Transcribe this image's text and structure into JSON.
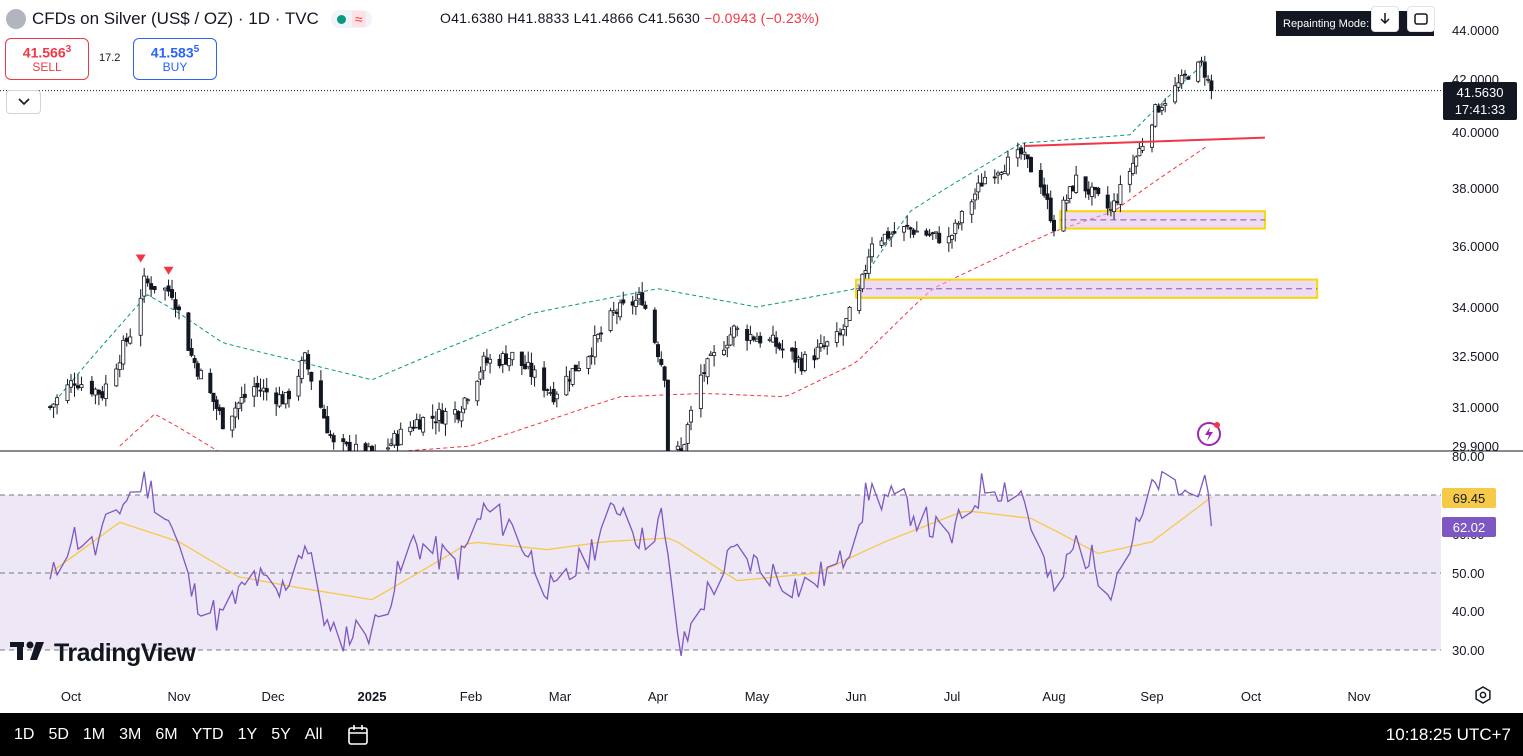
{
  "header": {
    "symbol_title": "CFDs on Silver (US$ / OZ) · 1D · TVC",
    "ohlc": {
      "o": "O41.6380",
      "h": "H41.8833",
      "l": "L41.4866",
      "c": "C41.5630",
      "change": "−0.0943 (−0.23%)"
    }
  },
  "trade": {
    "sell_main": "41.566",
    "sell_sup": "3",
    "sell_label": "SELL",
    "spread": "17.2",
    "buy_main": "41.583",
    "buy_sup": "5",
    "buy_label": "BUY"
  },
  "repaint_label": "Repainting Mode: off",
  "last_price": {
    "value": "41.5630",
    "countdown": "17:41:33"
  },
  "rsi_tags": {
    "ma": "69.45",
    "rsi": "62.02"
  },
  "timeframes": [
    "1D",
    "5D",
    "1M",
    "3M",
    "6M",
    "YTD",
    "1Y",
    "5Y",
    "All"
  ],
  "clock": "10:18:25 UTC+7",
  "brand": "TradingView",
  "icons": {
    "collapse": "chevron-down-icon",
    "download": "download-icon",
    "fullscreen": "fullscreen-icon",
    "calendar": "calendar-icon",
    "settings": "gear-icon",
    "flash": "flash-icon"
  },
  "colors": {
    "up": "#131722",
    "down": "#131722",
    "upper_band": "#089981",
    "lower_band": "#f23645",
    "resistance": "#f23645",
    "zone_border": "#f5d90a",
    "zone_fill": "#e1bee7",
    "rsi_line": "#7e57c2",
    "rsi_ma": "#f7c948",
    "rsi_fill": "#ede7f6"
  },
  "chart_data": [
    {
      "type": "candlestick",
      "title": "CFDs on Silver (US$ / OZ) · 1D · TVC",
      "y_ticks": [
        29.9,
        31.0,
        32.5,
        34.0,
        36.0,
        38.0,
        40.0,
        42.0,
        44.0
      ],
      "y_tick_labels": [
        "29.9000",
        "31.0000",
        "32.5000",
        "34.0000",
        "36.0000",
        "38.0000",
        "40.0000",
        "42.0000",
        "44.0000"
      ],
      "ylim": [
        29.9,
        44.5
      ],
      "x_tick_labels": [
        "Oct",
        "Nov",
        "Dec",
        "2025",
        "Feb",
        "Mar",
        "Apr",
        "May",
        "Jun",
        "Jul",
        "Aug",
        "Sep",
        "Oct",
        "Nov"
      ],
      "grid": false,
      "close_anchors": [
        {
          "date": "2024-09-25",
          "close": 31.0
        },
        {
          "date": "2024-10-02",
          "close": 31.8
        },
        {
          "date": "2024-10-10",
          "close": 31.4
        },
        {
          "date": "2024-10-18",
          "close": 33.2
        },
        {
          "date": "2024-10-22",
          "close": 34.8
        },
        {
          "date": "2024-10-30",
          "close": 34.5
        },
        {
          "date": "2024-11-05",
          "close": 32.5
        },
        {
          "date": "2024-11-15",
          "close": 30.6
        },
        {
          "date": "2024-11-25",
          "close": 31.6
        },
        {
          "date": "2024-12-05",
          "close": 31.2
        },
        {
          "date": "2024-12-11",
          "close": 32.4
        },
        {
          "date": "2024-12-20",
          "close": 29.9
        },
        {
          "date": "2025-01-02",
          "close": 29.6
        },
        {
          "date": "2025-01-15",
          "close": 30.6
        },
        {
          "date": "2025-01-28",
          "close": 30.9
        },
        {
          "date": "2025-02-05",
          "close": 32.3
        },
        {
          "date": "2025-02-14",
          "close": 32.5
        },
        {
          "date": "2025-02-27",
          "close": 31.4
        },
        {
          "date": "2025-03-10",
          "close": 32.6
        },
        {
          "date": "2025-03-18",
          "close": 33.8
        },
        {
          "date": "2025-03-27",
          "close": 34.3
        },
        {
          "date": "2025-04-03",
          "close": 32.0
        },
        {
          "date": "2025-04-04",
          "close": 29.8
        },
        {
          "date": "2025-04-08",
          "close": 29.7
        },
        {
          "date": "2025-04-14",
          "close": 31.9
        },
        {
          "date": "2025-04-24",
          "close": 33.3
        },
        {
          "date": "2025-05-06",
          "close": 32.9
        },
        {
          "date": "2025-05-15",
          "close": 32.3
        },
        {
          "date": "2025-05-27",
          "close": 33.1
        },
        {
          "date": "2025-06-02",
          "close": 34.4
        },
        {
          "date": "2025-06-06",
          "close": 36.2
        },
        {
          "date": "2025-06-17",
          "close": 36.6
        },
        {
          "date": "2025-06-30",
          "close": 36.2
        },
        {
          "date": "2025-07-11",
          "close": 38.4
        },
        {
          "date": "2025-07-22",
          "close": 39.2
        },
        {
          "date": "2025-07-28",
          "close": 38.2
        },
        {
          "date": "2025-08-01",
          "close": 36.7
        },
        {
          "date": "2025-08-08",
          "close": 38.3
        },
        {
          "date": "2025-08-19",
          "close": 37.2
        },
        {
          "date": "2025-08-29",
          "close": 39.6
        },
        {
          "date": "2025-09-02",
          "close": 40.8
        },
        {
          "date": "2025-09-12",
          "close": 42.2
        },
        {
          "date": "2025-09-16",
          "close": 42.6
        },
        {
          "date": "2025-09-19",
          "close": 41.563
        }
      ],
      "bands": {
        "upper": [
          {
            "date": "2024-09-25",
            "value": 31.0
          },
          {
            "date": "2024-10-23",
            "value": 34.4
          },
          {
            "date": "2024-11-15",
            "value": 32.9
          },
          {
            "date": "2025-01-01",
            "value": 31.8
          },
          {
            "date": "2025-02-20",
            "value": 33.8
          },
          {
            "date": "2025-04-01",
            "value": 34.6
          },
          {
            "date": "2025-05-01",
            "value": 34.0
          },
          {
            "date": "2025-06-01",
            "value": 34.6
          },
          {
            "date": "2025-06-18",
            "value": 37.2
          },
          {
            "date": "2025-07-22",
            "value": 39.6
          },
          {
            "date": "2025-08-25",
            "value": 39.9
          },
          {
            "date": "2025-09-19",
            "value": 42.9
          }
        ],
        "lower": [
          {
            "date": "2024-10-15",
            "value": 29.9
          },
          {
            "date": "2024-10-25",
            "value": 30.8
          },
          {
            "date": "2024-11-20",
            "value": 29.4
          },
          {
            "date": "2025-02-01",
            "value": 29.9
          },
          {
            "date": "2025-03-20",
            "value": 31.3
          },
          {
            "date": "2025-04-15",
            "value": 31.4
          },
          {
            "date": "2025-05-10",
            "value": 31.3
          },
          {
            "date": "2025-06-01",
            "value": 32.3
          },
          {
            "date": "2025-06-25",
            "value": 34.6
          },
          {
            "date": "2025-08-01",
            "value": 36.5
          },
          {
            "date": "2025-08-20",
            "value": 37.2
          },
          {
            "date": "2025-09-19",
            "value": 39.6
          }
        ]
      },
      "annotations": [
        {
          "kind": "sell-signal",
          "date": "2024-10-21",
          "value": 35.0
        },
        {
          "kind": "sell-signal",
          "date": "2024-10-29",
          "value": 34.6
        },
        {
          "kind": "resistance-line",
          "from_date": "2025-07-23",
          "to_date": "2025-10-05",
          "from": 39.5,
          "to": 39.8
        },
        {
          "kind": "zone",
          "from_date": "2025-08-03",
          "to_date": "2025-10-05",
          "low": 36.6,
          "high": 37.2,
          "mid": 36.9
        },
        {
          "kind": "zone",
          "from_date": "2025-06-01",
          "to_date": "2025-10-20",
          "low": 34.3,
          "high": 34.9,
          "mid": 34.6
        }
      ],
      "last_price": 41.563
    },
    {
      "type": "line",
      "title": "RSI",
      "y_ticks": [
        30,
        40,
        50,
        60,
        80
      ],
      "y_tick_labels": [
        "30.00",
        "40.00",
        "50.00",
        "60.00",
        "80.00"
      ],
      "ylim": [
        28,
        82
      ],
      "levels": [
        30,
        50,
        70
      ],
      "series": [
        {
          "id": "rsi",
          "anchors": [
            {
              "date": "2024-09-25",
              "value": 47
            },
            {
              "date": "2024-10-01",
              "value": 60
            },
            {
              "date": "2024-10-08",
              "value": 56
            },
            {
              "date": "2024-10-14",
              "value": 66
            },
            {
              "date": "2024-10-22",
              "value": 74
            },
            {
              "date": "2024-10-29",
              "value": 64
            },
            {
              "date": "2024-11-05",
              "value": 45
            },
            {
              "date": "2024-11-14",
              "value": 38
            },
            {
              "date": "2024-11-25",
              "value": 49
            },
            {
              "date": "2024-12-03",
              "value": 44
            },
            {
              "date": "2024-12-11",
              "value": 58
            },
            {
              "date": "2024-12-19",
              "value": 33
            },
            {
              "date": "2025-01-02",
              "value": 36
            },
            {
              "date": "2025-01-14",
              "value": 58
            },
            {
              "date": "2025-01-28",
              "value": 52
            },
            {
              "date": "2025-02-05",
              "value": 66
            },
            {
              "date": "2025-02-14",
              "value": 62
            },
            {
              "date": "2025-02-27",
              "value": 44
            },
            {
              "date": "2025-03-10",
              "value": 55
            },
            {
              "date": "2025-03-20",
              "value": 68
            },
            {
              "date": "2025-03-27",
              "value": 58
            },
            {
              "date": "2025-04-02",
              "value": 64
            },
            {
              "date": "2025-04-08",
              "value": 29
            },
            {
              "date": "2025-04-14",
              "value": 42
            },
            {
              "date": "2025-04-24",
              "value": 55
            },
            {
              "date": "2025-05-06",
              "value": 50
            },
            {
              "date": "2025-05-15",
              "value": 46
            },
            {
              "date": "2025-05-27",
              "value": 52
            },
            {
              "date": "2025-06-05",
              "value": 71
            },
            {
              "date": "2025-06-17",
              "value": 67
            },
            {
              "date": "2025-06-30",
              "value": 58
            },
            {
              "date": "2025-07-11",
              "value": 73
            },
            {
              "date": "2025-07-22",
              "value": 71
            },
            {
              "date": "2025-08-01",
              "value": 44
            },
            {
              "date": "2025-08-08",
              "value": 58
            },
            {
              "date": "2025-08-19",
              "value": 47
            },
            {
              "date": "2025-08-29",
              "value": 64
            },
            {
              "date": "2025-09-03",
              "value": 74
            },
            {
              "date": "2025-09-12",
              "value": 70
            },
            {
              "date": "2025-09-16",
              "value": 75
            },
            {
              "date": "2025-09-19",
              "value": 62.02
            }
          ]
        },
        {
          "id": "rsi_ma",
          "anchors": [
            {
              "date": "2024-09-25",
              "value": 50
            },
            {
              "date": "2024-10-15",
              "value": 63
            },
            {
              "date": "2024-11-01",
              "value": 58
            },
            {
              "date": "2024-11-20",
              "value": 49
            },
            {
              "date": "2024-12-10",
              "value": 46
            },
            {
              "date": "2025-01-01",
              "value": 43
            },
            {
              "date": "2025-02-01",
              "value": 58
            },
            {
              "date": "2025-02-25",
              "value": 56
            },
            {
              "date": "2025-03-15",
              "value": 58
            },
            {
              "date": "2025-04-05",
              "value": 59
            },
            {
              "date": "2025-04-25",
              "value": 48
            },
            {
              "date": "2025-05-20",
              "value": 50
            },
            {
              "date": "2025-06-10",
              "value": 58
            },
            {
              "date": "2025-07-05",
              "value": 66
            },
            {
              "date": "2025-07-25",
              "value": 64
            },
            {
              "date": "2025-08-15",
              "value": 55
            },
            {
              "date": "2025-09-01",
              "value": 58
            },
            {
              "date": "2025-09-19",
              "value": 69.45
            }
          ]
        }
      ]
    }
  ]
}
